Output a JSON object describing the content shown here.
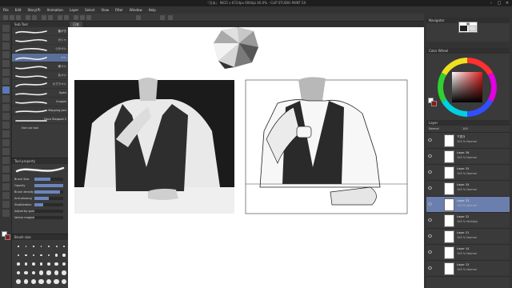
{
  "app": {
    "title": "『日本』 9815 x 6724px 600dpi 40.0%  - CLIP STUDIO PAINT EX",
    "window_controls": [
      "–",
      "□",
      "✕"
    ]
  },
  "menu": [
    "File",
    "Edit",
    "Story(P)",
    "Animation",
    "Layer",
    "Select",
    "View",
    "Filter",
    "Window",
    "Help"
  ],
  "document_tab": "日本",
  "subtool_panel": {
    "title": "Sub Tool",
    "selected_index": 3,
    "brushes": [
      "筆がき",
      "ガシャ",
      "つけペン",
      "ペン",
      "細ペン",
      "丸ペン",
      "カブラペン",
      "Gpen",
      "Croquis",
      "Mapping pen",
      "Deco Stepped 2"
    ],
    "extra_item": "Not use tool"
  },
  "tool_property": {
    "title": "Tool property",
    "rows": [
      {
        "label": "Brush Size",
        "value": 0.55
      },
      {
        "label": "Opacity",
        "value": 1.0
      },
      {
        "label": "Brush density",
        "value": 0.9
      },
      {
        "label": "Anti-aliasing",
        "value": 0.5
      },
      {
        "label": "Stabilization",
        "value": 0.3
      },
      {
        "label": "Adjust by speed",
        "value": 0.0
      },
      {
        "label": "Vector magnet",
        "value": 0.0
      }
    ]
  },
  "brush_size_panel": {
    "title": "Brush size"
  },
  "navigator": {
    "title": "Navigator"
  },
  "color_panel": {
    "title": "Color Wheel"
  },
  "layer_panel": {
    "title": "Layer",
    "blend_mode": "Normal",
    "opacity": "100",
    "selected_index": 4,
    "layers": [
      {
        "name": "下書き",
        "mode": "100 % Normal"
      },
      {
        "name": "Layer 26",
        "mode": "100 % Normal"
      },
      {
        "name": "Layer 25",
        "mode": "100 % Normal"
      },
      {
        "name": "Layer 24",
        "mode": "100 % Normal"
      },
      {
        "name": "Layer 23",
        "mode": "100 % Normal"
      },
      {
        "name": "Layer 22",
        "mode": "100 % Multiply"
      },
      {
        "name": "Layer 21",
        "mode": "100 % Normal"
      },
      {
        "name": "Layer 14",
        "mode": "100 % Normal"
      },
      {
        "name": "Layer 13",
        "mode": "100 % Normal"
      }
    ]
  },
  "colors": {
    "main": "#ffffff",
    "sub": "#8b1a1a",
    "accent": "#6b7fae"
  }
}
